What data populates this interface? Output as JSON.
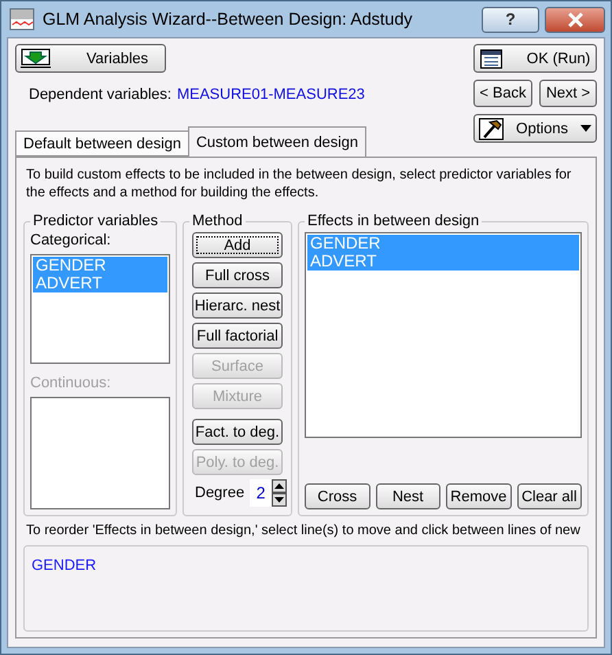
{
  "window": {
    "title": "GLM Analysis Wizard--Between Design: Adstudy",
    "help": "?"
  },
  "top_buttons": {
    "variables": "Variables",
    "ok": "OK (Run)",
    "back": "< Back",
    "next": "Next >",
    "options": "Options"
  },
  "dependent": {
    "label": "Dependent variables:",
    "value": "MEASURE01-MEASURE23"
  },
  "tabs": [
    {
      "label": "Default between design",
      "selected": false
    },
    {
      "label": "Custom between design",
      "selected": true
    }
  ],
  "description": "To build custom effects to be included in the between design, select predictor variables for the effects and a method for building the effects.",
  "predictor": {
    "title": "Predictor variables",
    "categorical_label": "Categorical:",
    "categorical": [
      {
        "label": "GENDER",
        "selected": true
      },
      {
        "label": "ADVERT",
        "selected": true
      }
    ],
    "continuous_label": "Continuous:",
    "continuous_disabled": true
  },
  "method": {
    "title": "Method",
    "buttons": [
      {
        "label": "Add",
        "disabled": false,
        "focused": true
      },
      {
        "label": "Full cross",
        "disabled": false,
        "focused": false
      },
      {
        "label": "Hierarc. nest",
        "disabled": false,
        "focused": false
      },
      {
        "label": "Full factorial",
        "disabled": false,
        "focused": false
      },
      {
        "label": "Surface",
        "disabled": true,
        "focused": false
      },
      {
        "label": "Mixture",
        "disabled": true,
        "focused": false
      },
      {
        "label": "Fact. to deg.",
        "disabled": false,
        "focused": false
      },
      {
        "label": "Poly. to deg.",
        "disabled": true,
        "focused": false
      }
    ],
    "degree_label": "Degree",
    "degree": "2"
  },
  "effects": {
    "title": "Effects in between design",
    "items": [
      {
        "label": "GENDER",
        "selected": true
      },
      {
        "label": "ADVERT",
        "selected": true
      }
    ],
    "buttons": [
      "Cross",
      "Nest",
      "Remove",
      "Clear all"
    ]
  },
  "reorder": {
    "text": "To reorder 'Effects in between design,' select line(s) to move and click between lines of new",
    "items": [
      "GENDER"
    ]
  }
}
